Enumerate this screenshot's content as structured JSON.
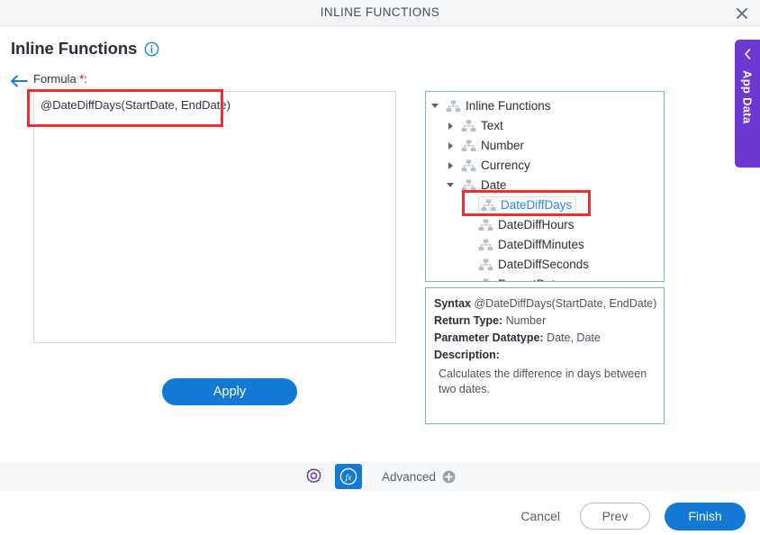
{
  "window": {
    "title": "INLINE FUNCTIONS",
    "close_icon": "close-icon"
  },
  "header": {
    "title": "Inline Functions",
    "info_icon": "info-icon"
  },
  "formula": {
    "back_icon": "back-arrow-icon",
    "label": "Formula ",
    "required_marker": "*:",
    "value": "@DateDiffDays(StartDate, EndDate)",
    "placeholder": ""
  },
  "apply": {
    "label": "Apply"
  },
  "tree": {
    "nodes": [
      {
        "label": "Inline Functions",
        "indent": 0,
        "toggle": "expanded",
        "selected": false,
        "icon": "hierarchy-icon"
      },
      {
        "label": "Text",
        "indent": 1,
        "toggle": "collapsed",
        "selected": false,
        "icon": "hierarchy-icon"
      },
      {
        "label": "Number",
        "indent": 1,
        "toggle": "collapsed",
        "selected": false,
        "icon": "hierarchy-icon"
      },
      {
        "label": "Currency",
        "indent": 1,
        "toggle": "collapsed",
        "selected": false,
        "icon": "hierarchy-icon"
      },
      {
        "label": "Date",
        "indent": 1,
        "toggle": "expanded",
        "selected": false,
        "icon": "hierarchy-icon"
      },
      {
        "label": "DateDiffDays",
        "indent": 2,
        "toggle": "none",
        "selected": true,
        "icon": "hierarchy-icon"
      },
      {
        "label": "DateDiffHours",
        "indent": 2,
        "toggle": "none",
        "selected": false,
        "icon": "hierarchy-icon"
      },
      {
        "label": "DateDiffMinutes",
        "indent": 2,
        "toggle": "none",
        "selected": false,
        "icon": "hierarchy-icon"
      },
      {
        "label": "DateDiffSeconds",
        "indent": 2,
        "toggle": "none",
        "selected": false,
        "icon": "hierarchy-icon"
      },
      {
        "label": "FormatDate",
        "indent": 2,
        "toggle": "none",
        "selected": false,
        "icon": "hierarchy-icon"
      }
    ]
  },
  "syntax_panel": {
    "syntax_label": "Syntax",
    "syntax_value": "@DateDiffDays(StartDate, EndDate)",
    "return_type_label": "Return Type:",
    "return_type_value": "Number",
    "param_datatype_label": "Parameter Datatype:",
    "param_datatype_value": "Date, Date",
    "description_label": "Description:",
    "description_value": "Calculates the difference in days between two dates."
  },
  "app_data_tab": {
    "label": "App Data",
    "chevron_icon": "chevron-left-icon"
  },
  "advanced_bar": {
    "gear_icon": "gear-icon",
    "fx_icon": "fx-icon",
    "fx_glyph": "fx",
    "label": "Advanced",
    "plus_icon": "plus-circle-icon"
  },
  "footer": {
    "cancel_label": "Cancel",
    "prev_label": "Prev",
    "finish_label": "Finish"
  },
  "colors": {
    "accent_blue": "#1279d4",
    "link_blue": "#2f86d6",
    "app_data_purple": "#6b38d4",
    "annotation_red": "#f22c2c",
    "panel_border_blue": "#7fb2cc",
    "titlebar_bg": "#f4f5f7",
    "toolbar_bg": "#f7f8fa",
    "required_red": "#d0021b"
  }
}
